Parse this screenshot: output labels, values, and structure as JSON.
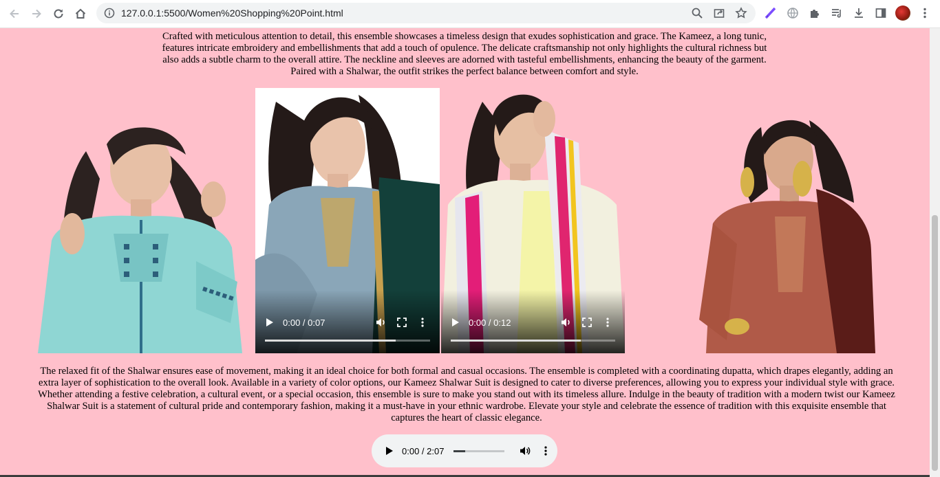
{
  "browser": {
    "url": "127.0.0.1:5500/Women%20Shopping%20Point.html",
    "icons": [
      "back-icon",
      "forward-icon",
      "reload-icon",
      "home-icon",
      "info-icon",
      "zoom-icon",
      "share-icon",
      "star-icon",
      "pen-extension-icon",
      "globe-extension-icon",
      "puzzle-icon",
      "reading-list-icon",
      "download-icon",
      "side-panel-icon",
      "profile-avatar",
      "menu-icon"
    ]
  },
  "page": {
    "paragraph_top": "Crafted with meticulous attention to detail, this ensemble showcases a timeless design that exudes sophistication and grace. The Kameez, a long tunic, features intricate embroidery and embellishments that add a touch of opulence. The delicate craftsmanship not only highlights the cultural richness but also adds a subtle charm to the overall attire. The neckline and sleeves are adorned with tasteful embellishments, enhancing the beauty of the garment. Paired with a Shalwar, the outfit strikes the perfect balance between comfort and style.",
    "paragraph_bottom": "The relaxed fit of the Shalwar ensures ease of movement, making it an ideal choice for both formal and casual occasions. The ensemble is completed with a coordinating dupatta, which drapes elegantly, adding an extra layer of sophistication to the overall look. Available in a variety of color options, our Kameez Shalwar Suit is designed to cater to diverse preferences, allowing you to express your individual style with grace. Whether attending a festive celebration, a cultural event, or a special occasion, this ensemble is sure to make you stand out with its timeless allure. Indulge in the beauty of tradition with a modern twist our Kameez Shalwar Suit is a statement of cultural pride and contemporary fashion, making it a must-have in your ethnic wardrobe. Elevate your style and celebrate the essence of tradition with this exquisite ensemble that captures the heart of classic elegance."
  },
  "videos": [
    {
      "time": "0:00 / 0:07",
      "progress": 0.79
    },
    {
      "time": "0:00 / 0:12",
      "progress": 0.79
    }
  ],
  "audio": {
    "time": "0:00 / 2:07",
    "progress": 0.22
  },
  "colors": {
    "page_bg": "#ffc0cb",
    "chrome_bg": "#ffffff",
    "omnibox_bg": "#f1f3f4"
  }
}
